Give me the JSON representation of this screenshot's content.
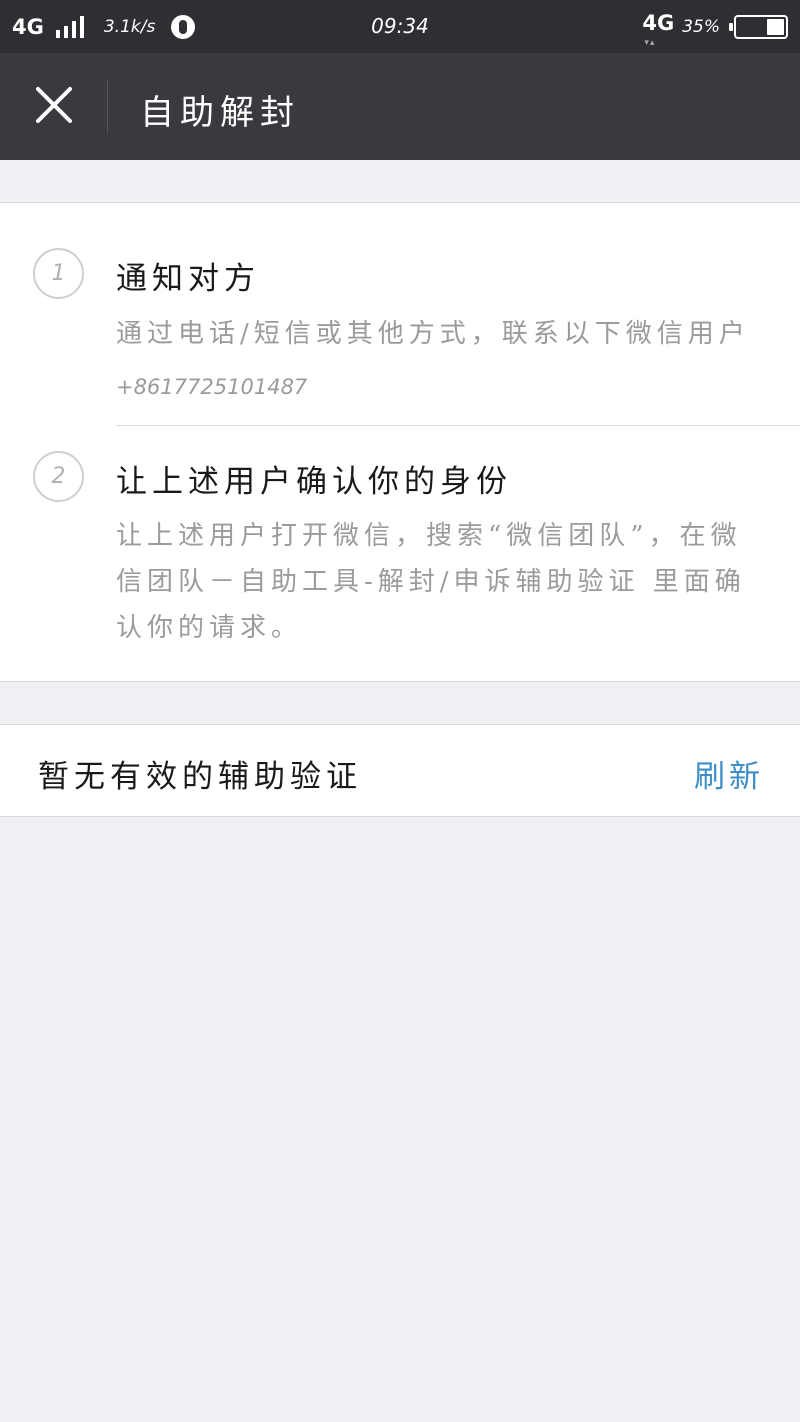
{
  "status_bar": {
    "network_left": "4G",
    "speed": "3.1k/s",
    "time": "09:34",
    "network_right": "4G",
    "battery_percent": "35%",
    "battery_level": 0.35
  },
  "title_bar": {
    "close_icon": "close-icon",
    "title": "自助解封"
  },
  "steps": [
    {
      "number": "1",
      "title": "通知对方",
      "description": "通过电话/短信或其他方式，联系以下微信用户",
      "phone": "+8617725101487"
    },
    {
      "number": "2",
      "title": "让上述用户确认你的身份",
      "description": "让上述用户打开微信，搜索“微信团队”，在微信团队－自助工具-解封/申诉辅助验证 里面确认你的请求。"
    }
  ],
  "assist": {
    "status": "暂无有效的辅助验证",
    "refresh_label": "刷新"
  },
  "colors": {
    "status_bar_bg": "#2e2f33",
    "title_bar_bg": "#393a3f",
    "page_bg": "#efeff4",
    "link": "#3d8ec9"
  }
}
